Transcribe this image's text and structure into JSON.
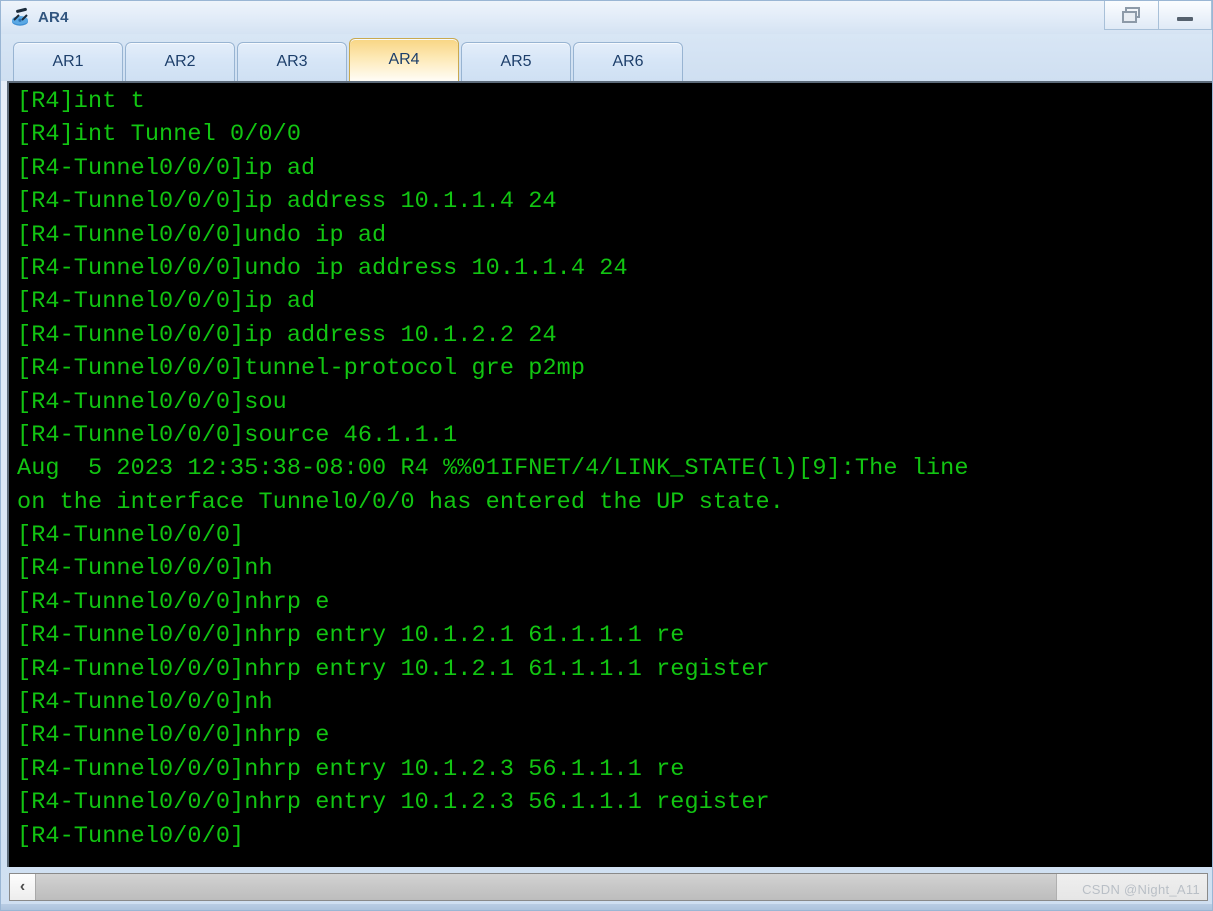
{
  "window": {
    "title": "AR4",
    "icon": "router-icon",
    "buttons": [
      {
        "name": "restore-button",
        "icon": "restore-icon",
        "label": ""
      },
      {
        "name": "minimize-button",
        "icon": "minimize-icon",
        "label": ""
      }
    ]
  },
  "tabs": [
    {
      "label": "AR1",
      "active": false
    },
    {
      "label": "AR2",
      "active": false
    },
    {
      "label": "AR3",
      "active": false
    },
    {
      "label": "AR4",
      "active": true
    },
    {
      "label": "AR5",
      "active": false
    },
    {
      "label": "AR6",
      "active": false
    }
  ],
  "terminal": {
    "foreground": "#12c512",
    "background": "#000000",
    "lines": [
      "[R4]int t",
      "[R4]int Tunnel 0/0/0",
      "[R4-Tunnel0/0/0]ip ad",
      "[R4-Tunnel0/0/0]ip address 10.1.1.4 24",
      "[R4-Tunnel0/0/0]undo ip ad",
      "[R4-Tunnel0/0/0]undo ip address 10.1.1.4 24",
      "[R4-Tunnel0/0/0]ip ad",
      "[R4-Tunnel0/0/0]ip address 10.1.2.2 24",
      "[R4-Tunnel0/0/0]tunnel-protocol gre p2mp",
      "[R4-Tunnel0/0/0]sou",
      "[R4-Tunnel0/0/0]source 46.1.1.1",
      "Aug  5 2023 12:35:38-08:00 R4 %%01IFNET/4/LINK_STATE(l)[9]:The line",
      "on the interface Tunnel0/0/0 has entered the UP state.",
      "[R4-Tunnel0/0/0]",
      "[R4-Tunnel0/0/0]nh",
      "[R4-Tunnel0/0/0]nhrp e",
      "[R4-Tunnel0/0/0]nhrp entry 10.1.2.1 61.1.1.1 re",
      "[R4-Tunnel0/0/0]nhrp entry 10.1.2.1 61.1.1.1 register",
      "[R4-Tunnel0/0/0]nh",
      "[R4-Tunnel0/0/0]nhrp e",
      "[R4-Tunnel0/0/0]nhrp entry 10.1.2.3 56.1.1.1 re",
      "[R4-Tunnel0/0/0]nhrp entry 10.1.2.3 56.1.1.1 register",
      "[R4-Tunnel0/0/0]"
    ]
  },
  "scrollbar": {
    "left_arrow": "‹",
    "orientation": "horizontal"
  },
  "watermark": {
    "text": "CSDN @Night_A11"
  }
}
